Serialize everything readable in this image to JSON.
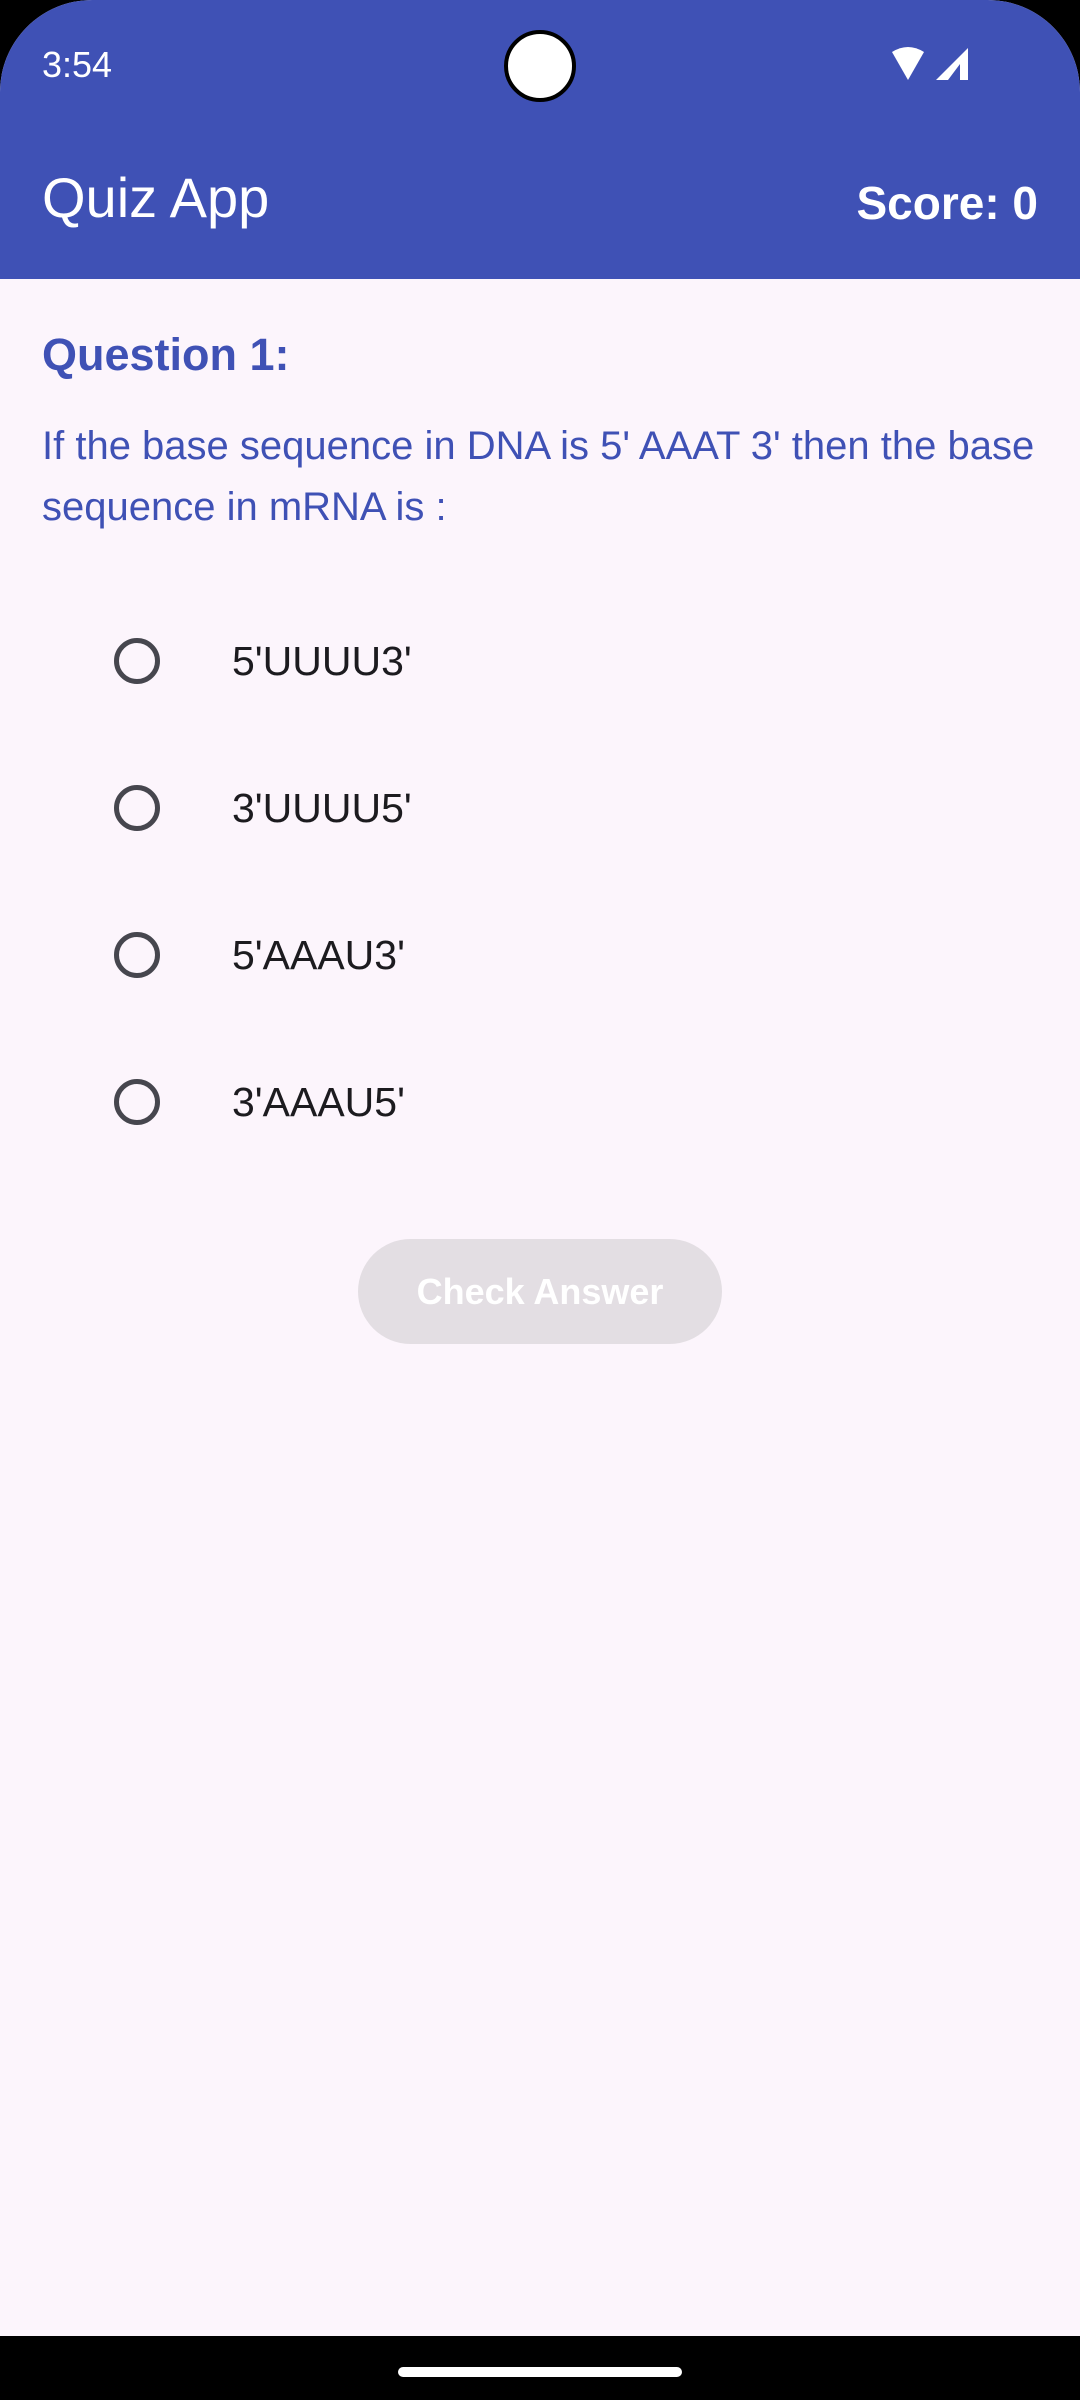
{
  "status_bar": {
    "time": "3:54",
    "icons": [
      "wifi-icon",
      "signal-icon"
    ]
  },
  "app_bar": {
    "title": "Quiz App",
    "score": "Score: 0",
    "color": "#3F51B5"
  },
  "question": {
    "label": "Question 1:",
    "text": "If the base sequence in DNA is 5' AAAT 3' then the base sequence in mRNA is :"
  },
  "options": [
    {
      "label": "5'UUUU3'",
      "selected": false
    },
    {
      "label": "3'UUUU5'",
      "selected": false
    },
    {
      "label": "5'AAAU3'",
      "selected": false
    },
    {
      "label": "3'AAAU5'",
      "selected": false
    }
  ],
  "actions": {
    "check_label": "Check Answer",
    "check_enabled": false
  }
}
